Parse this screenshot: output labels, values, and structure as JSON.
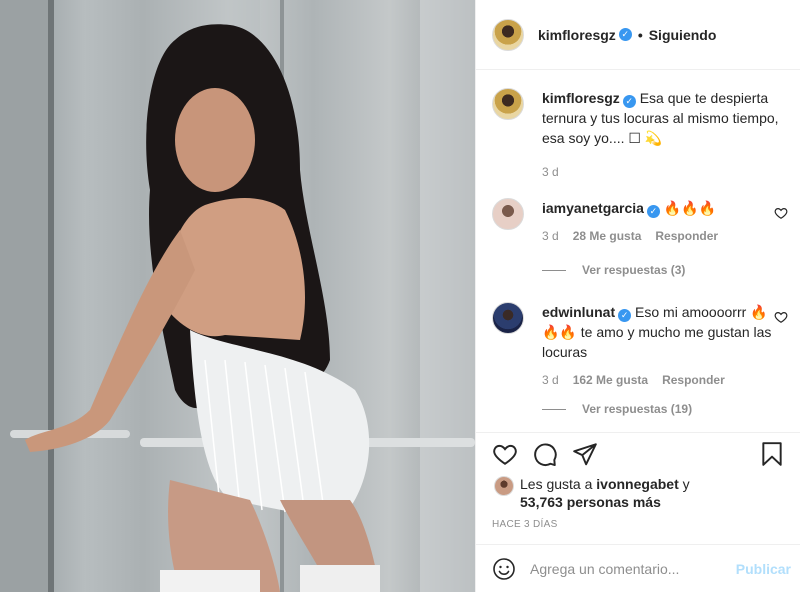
{
  "header": {
    "username": "kimfloresgz",
    "separator": "•",
    "follow_label": "Siguiendo"
  },
  "caption": {
    "username": "kimfloresgz",
    "text": "Esa que te despierta ternura y tus locuras al mismo tiempo, esa soy yo.... ☐ 💫",
    "time": "3 d"
  },
  "comments": [
    {
      "username": "iamyanetgarcia",
      "text": "🔥🔥🔥",
      "time": "3 d",
      "likes": "28 Me gusta",
      "reply_label": "Responder",
      "view_replies": "Ver respuestas (3)"
    },
    {
      "username": "edwinlunat",
      "text": "Eso mi amoooorrr 🔥🔥🔥 te amo y mucho me gustan las locuras",
      "time": "3 d",
      "likes": "162 Me gusta",
      "reply_label": "Responder",
      "view_replies": "Ver respuestas (19)"
    }
  ],
  "likes": {
    "prefix": "Les gusta a ",
    "user": "ivonnegabet",
    "suffix": " y",
    "count_line": "53,763 personas más"
  },
  "posted_ago": "HACE 3 DÍAS",
  "add_comment": {
    "placeholder": "Agrega un comentario...",
    "post_label": "Publicar"
  },
  "icons": {
    "like": "heart-icon",
    "comment": "comment-icon",
    "share": "share-icon",
    "save": "bookmark-icon",
    "emoji": "smiley-icon",
    "verified": "verified-badge-icon"
  },
  "colors": {
    "verified": "#3897f0",
    "secondary_text": "#8e8e8e",
    "post_button_disabled": "#b2dffc",
    "divider": "#efefef"
  }
}
